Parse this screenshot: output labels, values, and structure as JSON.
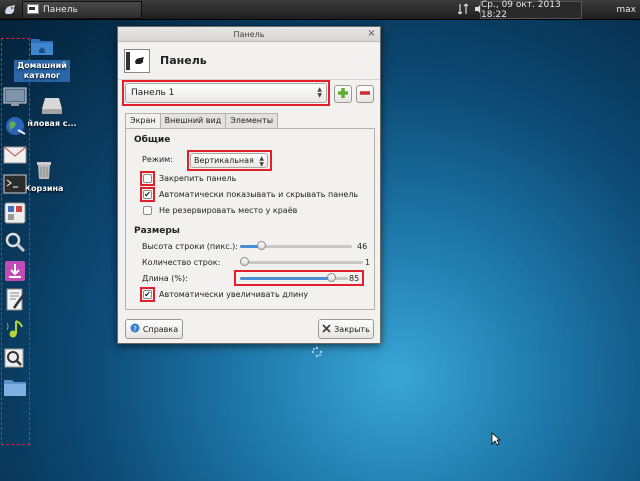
{
  "taskbar": {
    "window_button_label": "Панель",
    "clock": "Ср., 09 окт. 2013 18:22",
    "user": "max"
  },
  "desktop": {
    "icons": [
      {
        "label": "Домашний каталог"
      },
      {
        "label": "йловая с..."
      },
      {
        "label": "Корзина"
      }
    ]
  },
  "dock": {
    "items": [
      "monitor-icon",
      "browser-globe-icon",
      "mail-icon",
      "terminal-icon",
      "settings-icon",
      "search-icon",
      "download-icon",
      "editor-icon",
      "music-icon",
      "find-files-icon",
      "folder-icon"
    ]
  },
  "dialog": {
    "window_title": "Панель",
    "header_title": "Панель",
    "panel_select_value": "Панель 1",
    "tabs": [
      "Экран",
      "Внешний вид",
      "Элементы"
    ],
    "active_tab": "Экран",
    "general": {
      "title": "Общие",
      "mode_label": "Режим:",
      "mode_value": "Вертикальная",
      "lock_label": "Закрепить панель",
      "lock_checked": false,
      "autohide_label": "Автоматически показывать и скрывать панель",
      "autohide_checked": true,
      "reserve_label": "Не резервировать место у краёв",
      "reserve_checked": false
    },
    "dimensions": {
      "title": "Размеры",
      "row_size_label": "Высота строки (пикс.):",
      "row_size_value": "46",
      "row_size_fraction": 0.2,
      "rows_label": "Количество строк:",
      "rows_value": "1",
      "rows_fraction": 0.0,
      "length_label": "Длина (%):",
      "length_value": "85",
      "length_fraction": 0.85,
      "autolength_label": "Автоматически увеличивать длину",
      "autolength_checked": true
    },
    "help_button": "Справка",
    "close_button": "Закрыть"
  },
  "colors": {
    "highlight": "#e0202a",
    "slider_fill": "#4a8fd6"
  }
}
